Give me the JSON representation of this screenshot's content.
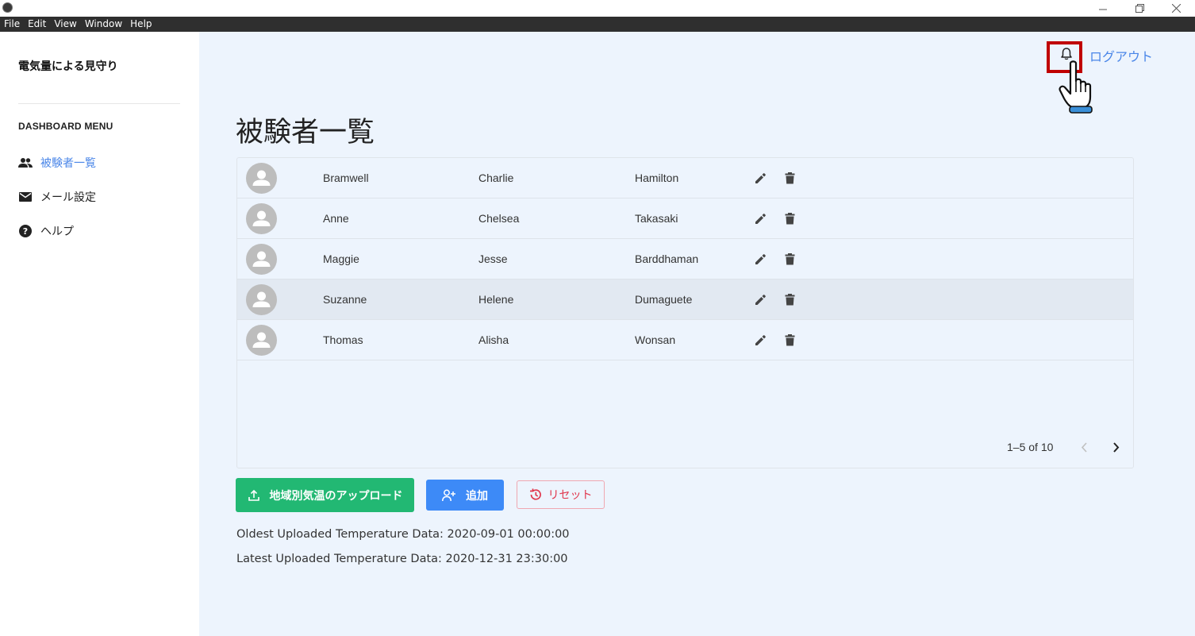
{
  "window": {
    "controls": [
      "minimize-icon",
      "restore-icon",
      "close-icon"
    ]
  },
  "menubar": {
    "items": [
      "File",
      "Edit",
      "View",
      "Window",
      "Help"
    ]
  },
  "sidebar": {
    "app_title": "電気量による見守り",
    "heading": "DASHBOARD MENU",
    "items": [
      {
        "label": "被験者一覧",
        "icon": "people-icon",
        "active": true
      },
      {
        "label": "メール設定",
        "icon": "mail-icon",
        "active": false
      },
      {
        "label": "ヘルプ",
        "icon": "help-icon",
        "active": false
      }
    ]
  },
  "header": {
    "bell_icon": "bell-icon",
    "logout_label": "ログアウト"
  },
  "main": {
    "page_title": "被験者一覧",
    "rows": [
      {
        "col1": "Bramwell",
        "col2": "Charlie",
        "col3": "Hamilton"
      },
      {
        "col1": "Anne",
        "col2": "Chelsea",
        "col3": "Takasaki"
      },
      {
        "col1": "Maggie",
        "col2": "Jesse",
        "col3": "Barddhaman"
      },
      {
        "col1": "Suzanne",
        "col2": "Helene",
        "col3": "Dumaguete"
      },
      {
        "col1": "Thomas",
        "col2": "Alisha",
        "col3": "Wonsan"
      }
    ],
    "pagination": {
      "text": "1–5 of 10"
    },
    "buttons": {
      "upload_label": "地域別気温のアップロード",
      "add_label": "追加",
      "reset_label": "リセット"
    },
    "oldest_data": "Oldest Uploaded Temperature Data: 2020-09-01 00:00:00",
    "latest_data": "Latest Uploaded Temperature Data: 2020-12-31 23:30:00"
  },
  "colors": {
    "accent_blue": "#4a86e8",
    "upload_green": "#22b873",
    "add_blue": "#3d8af7",
    "reset_red": "#e0364c",
    "main_bg": "#edf4fd",
    "highlight_red": "#c00000"
  }
}
